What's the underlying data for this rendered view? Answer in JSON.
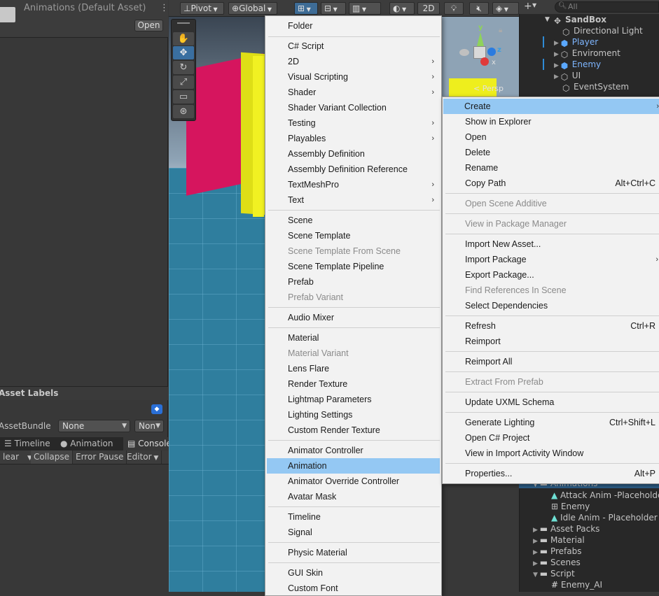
{
  "inspector": {
    "title": "Animations (Default Asset)",
    "open_label": "Open",
    "asset_labels": "Asset Labels",
    "asset_bundle_label": "AssetBundle",
    "bundle_value": "None",
    "bundle_variant": "Non"
  },
  "console": {
    "tabs": [
      "Timeline",
      "Animation",
      "Console"
    ],
    "toolbar": [
      "lear",
      "Collapse",
      "Error Pause",
      "Editor"
    ]
  },
  "scene_toolbar": {
    "pivot": "Pivot",
    "global": "Global",
    "mode_2d": "2D",
    "persp": "< Persp"
  },
  "hierarchy": {
    "search_placeholder": "All",
    "items": [
      {
        "label": "SandBox",
        "icon": "unity-scene-icon"
      },
      {
        "label": "Directional Light",
        "icon": "gameobject-icon"
      },
      {
        "label": "Player",
        "icon": "prefab-icon"
      },
      {
        "label": "Enviroment",
        "icon": "gameobject-icon"
      },
      {
        "label": "Enemy",
        "icon": "prefab-icon"
      },
      {
        "label": "UI",
        "icon": "gameobject-icon"
      },
      {
        "label": "EventSystem",
        "icon": "gameobject-icon"
      }
    ]
  },
  "project": {
    "items": [
      {
        "label": "Animations",
        "icon": "folder-icon"
      },
      {
        "label": "Attack Anim -Placeholder",
        "icon": "animation-clip-icon"
      },
      {
        "label": "Enemy",
        "icon": "animator-controller-icon"
      },
      {
        "label": "Idle Anim - Placeholder",
        "icon": "animation-clip-icon"
      },
      {
        "label": "Asset Packs",
        "icon": "folder-icon"
      },
      {
        "label": "Material",
        "icon": "folder-icon"
      },
      {
        "label": "Prefabs",
        "icon": "folder-icon"
      },
      {
        "label": "Scenes",
        "icon": "folder-icon"
      },
      {
        "label": "Script",
        "icon": "folder-icon"
      },
      {
        "label": "Enemy_AI",
        "icon": "csharp-script-icon"
      }
    ]
  },
  "create_menu": {
    "items": [
      "Folder",
      "C# Script",
      "2D",
      "Visual Scripting",
      "Shader",
      "Shader Variant Collection",
      "Testing",
      "Playables",
      "Assembly Definition",
      "Assembly Definition Reference",
      "TextMeshPro",
      "Text",
      "Scene",
      "Scene Template",
      "Scene Template From Scene",
      "Scene Template Pipeline",
      "Prefab",
      "Prefab Variant",
      "Audio Mixer",
      "Material",
      "Material Variant",
      "Lens Flare",
      "Render Texture",
      "Lightmap Parameters",
      "Lighting Settings",
      "Custom Render Texture",
      "Animator Controller",
      "Animation",
      "Animator Override Controller",
      "Avatar Mask",
      "Timeline",
      "Signal",
      "Physic Material",
      "GUI Skin",
      "Custom Font"
    ]
  },
  "context_menu": {
    "items": [
      "Create",
      "Show in Explorer",
      "Open",
      "Delete",
      "Rename",
      "Copy Path",
      "Open Scene Additive",
      "View in Package Manager",
      "Import New Asset...",
      "Import Package",
      "Export Package...",
      "Find References In Scene",
      "Select Dependencies",
      "Refresh",
      "Reimport",
      "Reimport All",
      "Extract From Prefab",
      "Update UXML Schema",
      "Generate Lighting",
      "Open C# Project",
      "View in Import Activity Window",
      "Properties..."
    ],
    "shortcuts": {
      "copy_path": "Alt+Ctrl+C",
      "refresh": "Ctrl+R",
      "generate_lighting": "Ctrl+Shift+L",
      "properties": "Alt+P"
    }
  },
  "colors": {
    "menu_highlight": "#94c8f3",
    "editor_bg": "#383838",
    "pink_cube": "#d6155e",
    "yellow_cube": "#eeee1d"
  }
}
